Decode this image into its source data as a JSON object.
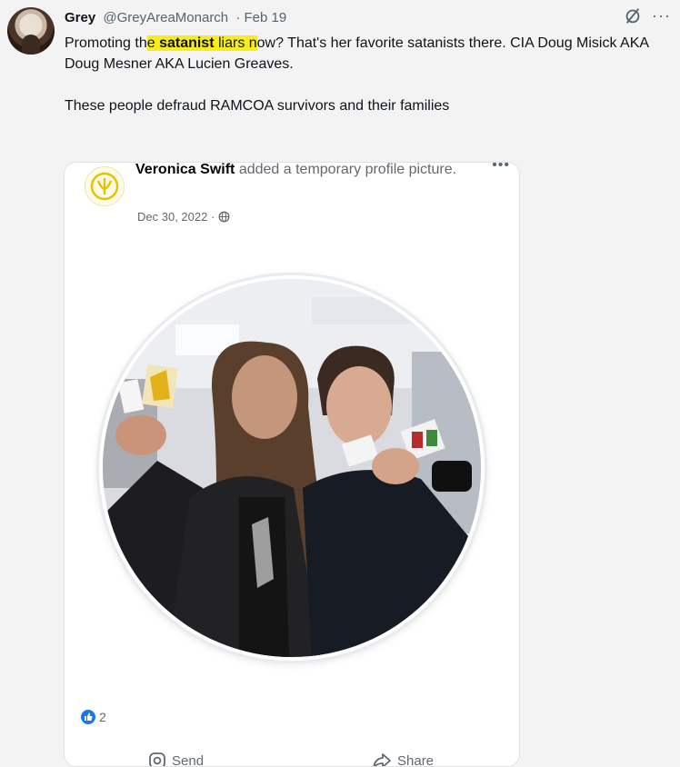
{
  "tweet": {
    "author_name": "Grey",
    "author_handle": "@GreyAreaMonarch",
    "date": "· Feb 19",
    "text_part1": "Promoting th",
    "highlight_pre": "e ",
    "highlight_bold": "satanist",
    "highlight_post": " liars n",
    "text_part2": "ow? That's her favorite satanists there. CIA Doug Misick AKA Doug Mesner AKA Lucien Greaves.",
    "text_paragraph2": "These people defraud RAMCOA survivors and their families",
    "highlight_color": "#f6ec1e"
  },
  "icons": {
    "grok": "grok-icon",
    "more": "more-icon"
  },
  "embedded_post": {
    "poster_name": "Veronica Swift",
    "action_text": " added a temporary profile picture.",
    "date": "Dec 30, 2022 ·",
    "more_label": "•••",
    "reaction_count": "2",
    "send_label": "Send",
    "share_label": "Share",
    "brand_color": "#1877f2"
  }
}
